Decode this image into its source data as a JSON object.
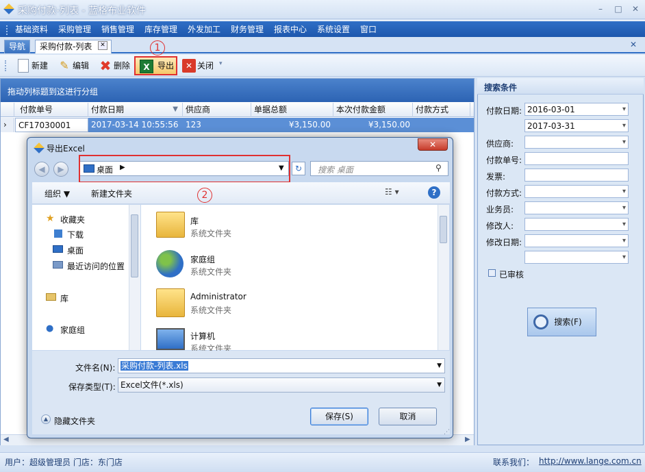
{
  "window": {
    "title": "采购付款-列表 - 蓝格布业软件",
    "min": "–",
    "max": "□",
    "close": "✕"
  },
  "menu": [
    "基础资料",
    "采购管理",
    "销售管理",
    "库存管理",
    "外发加工",
    "财务管理",
    "报表中心",
    "系统设置",
    "窗口"
  ],
  "tabs": {
    "nav": "导航",
    "active": "采购付款-列表",
    "close": "✕"
  },
  "toolbar": {
    "new": "新建",
    "edit": "编辑",
    "delete": "删除",
    "export": "导出",
    "close": "关闭"
  },
  "grid": {
    "group_hint": "拖动列标题到这进行分组",
    "columns": [
      "付款单号",
      "付款日期",
      "供应商",
      "单据总额",
      "本次付款金额",
      "付款方式"
    ],
    "rows": [
      {
        "id": "CF17030001",
        "date": "2017-03-14 10:55:56",
        "supplier": "123",
        "total": "¥3,150.00",
        "paid": "¥3,150.00",
        "method": ""
      }
    ]
  },
  "search": {
    "title": "搜索条件",
    "pay_date_label": "付款日期:",
    "date_from": "2016-03-01",
    "date_to": "2017-03-31",
    "supplier_label": "供应商:",
    "pay_no_label": "付款单号:",
    "invoice_label": "发票:",
    "pay_method_label": "付款方式:",
    "staff_label": "业务员:",
    "modifier_label": "修改人:",
    "modify_date_label": "修改日期:",
    "audited_label": "已审核",
    "search_button": "搜索(F)"
  },
  "status": {
    "user": "用户：超级管理员  门店：东门店",
    "contact_label": "联系我们：",
    "url": "http://www.lange.com.cn"
  },
  "dialog": {
    "title": "导出Excel",
    "address": "桌面",
    "search_placeholder": "搜索 桌面",
    "organize": "组织 ▼",
    "new_folder": "新建文件夹",
    "nav": {
      "favorites": "收藏夹",
      "downloads": "下载",
      "desktop": "桌面",
      "recent": "最近访问的位置",
      "libraries": "库",
      "homegroup": "家庭组"
    },
    "files": [
      {
        "name": "库",
        "type": "系统文件夹"
      },
      {
        "name": "家庭组",
        "type": "系统文件夹"
      },
      {
        "name": "Administrator",
        "type": "系统文件夹"
      },
      {
        "name": "计算机",
        "type": "系统文件夹"
      }
    ],
    "filename_label": "文件名(N):",
    "filename_value": "采购付款-列表.xls",
    "filetype_label": "保存类型(T):",
    "filetype_value": "Excel文件(*.xls)",
    "hide_folders": "隐藏文件夹",
    "save": "保存(S)",
    "cancel": "取消"
  },
  "annotations": {
    "one": "1",
    "two": "2"
  }
}
